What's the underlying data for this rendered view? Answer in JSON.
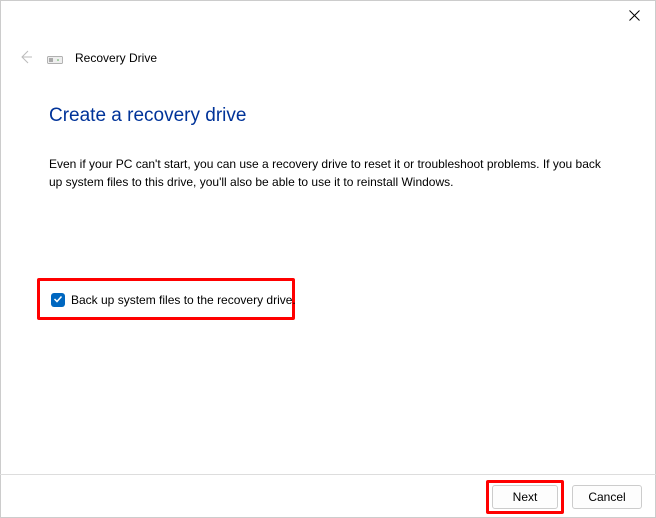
{
  "header": {
    "title": "Recovery Drive"
  },
  "main": {
    "heading": "Create a recovery drive",
    "description": "Even if your PC can't start, you can use a recovery drive to reset it or troubleshoot problems. If you back up system files to this drive, you'll also be able to use it to reinstall Windows."
  },
  "checkbox": {
    "label": "Back up system files to the recovery drive.",
    "checked": true
  },
  "buttons": {
    "next": "Next",
    "cancel": "Cancel"
  }
}
